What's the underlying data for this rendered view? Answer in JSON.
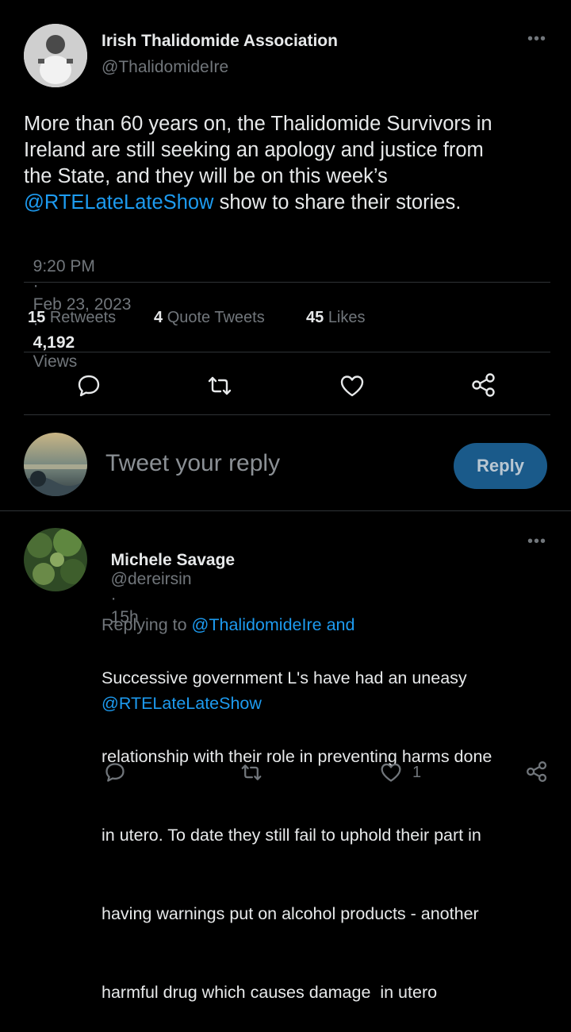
{
  "tweet": {
    "author_name": "Irish Thalidomide Association",
    "author_handle": "@ThalidomideIre",
    "text_line1": "More than 60 years on, the Thalidomide Survivors in",
    "text_line2": "Ireland are still seeking an apology and justice from",
    "text_line3": "the State, and they will be on this week’s",
    "mention": "@RTELateLateShow",
    "text_tail": " show to share their stories.",
    "time": "9:20 PM",
    "sep": "·",
    "date": "Feb 23, 2023",
    "views_count": "4,192",
    "views_label": "Views",
    "stats": [
      {
        "count": "15",
        "label": "Retweets"
      },
      {
        "count": "4",
        "label": "Quote Tweets"
      },
      {
        "count": "45",
        "label": "Likes"
      }
    ]
  },
  "compose": {
    "placeholder": "Tweet your reply",
    "reply_label": "Reply"
  },
  "reply": {
    "author_name": "Michele Savage",
    "author_handle": "@dereirsin",
    "sep": "·",
    "time": "15h",
    "replying_prefix": "Replying to ",
    "replying_user1": "@ThalidomideIre",
    "replying_and": " and",
    "replying_user2": "@RTELateLateShow",
    "lines": [
      "Successive government L's have had an uneasy",
      "relationship with their role in preventing harms done",
      "in utero. To date they still fail to uphold their part in",
      "having warnings put on alcohol products - another",
      "harmful drug which causes damage  in utero"
    ],
    "like_count": "1"
  },
  "icons": {
    "more": "more-dots-icon",
    "comment": "comment-icon",
    "retweet": "retweet-icon",
    "like": "heart-icon",
    "share": "share-icon"
  },
  "colors": {
    "background": "#000000",
    "text": "#e7e9ea",
    "muted": "#71767b",
    "link": "#1d9bf0",
    "reply_button": "#1a5a8a",
    "divider": "#2f3336"
  }
}
